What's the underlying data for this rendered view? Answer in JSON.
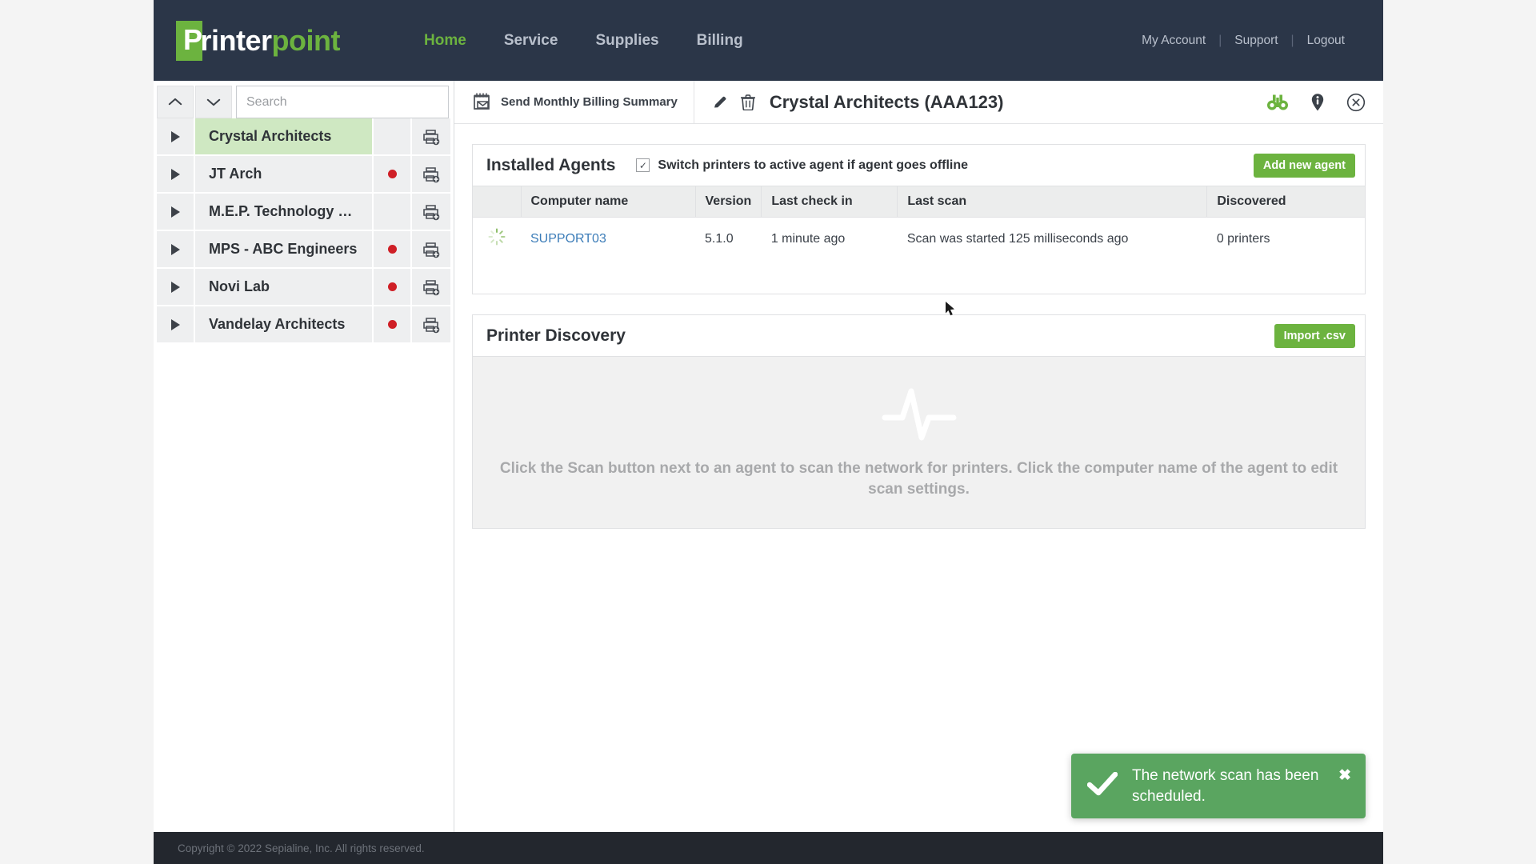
{
  "header": {
    "logo": {
      "badge_letter": "P",
      "white_part": "rinter",
      "green_part": "point",
      "accent": "#6cb33f"
    },
    "nav": [
      {
        "label": "Home",
        "active": true
      },
      {
        "label": "Service",
        "active": false
      },
      {
        "label": "Supplies",
        "active": false
      },
      {
        "label": "Billing",
        "active": false
      }
    ],
    "account_links": [
      {
        "label": "My Account"
      },
      {
        "label": "Support"
      },
      {
        "label": "Logout"
      }
    ],
    "separator": "|"
  },
  "sidebar": {
    "collapse_all_icon": "chevron-up-icon",
    "expand_all_icon": "chevron-down-icon",
    "search": {
      "value": "",
      "placeholder": "Search"
    },
    "customers": [
      {
        "name": "Crystal Architects",
        "selected": true,
        "alert": false
      },
      {
        "name": "JT Arch",
        "selected": false,
        "alert": true
      },
      {
        "name": "M.E.P. Technology …",
        "selected": false,
        "alert": false
      },
      {
        "name": "MPS - ABC Engineers",
        "selected": false,
        "alert": true
      },
      {
        "name": "Novi Lab",
        "selected": false,
        "alert": true
      },
      {
        "name": "Vandelay Architects",
        "selected": false,
        "alert": true
      }
    ],
    "row_print_icon": "add-printer-icon",
    "alert_color": "#cf1f26",
    "selected_bg": "#cfe8c2"
  },
  "context_bar": {
    "billing_button": {
      "label": "Send Monthly Billing Summary",
      "icon": "calendar-mail-icon"
    },
    "edit_icon": "pencil-icon",
    "delete_icon": "trash-icon",
    "title": "Crystal Architects (AAA123)",
    "right_icons": [
      {
        "name": "binoculars-icon",
        "color": "#6cb33f"
      },
      {
        "name": "info-pin-icon",
        "color": "#3b4149"
      },
      {
        "name": "close-circle-icon",
        "color": "#3b4149"
      }
    ]
  },
  "installed_agents": {
    "title": "Installed Agents",
    "switch_option": {
      "label": "Switch printers to active agent if agent goes offline",
      "checked": true
    },
    "add_button": "Add new agent",
    "columns": [
      "",
      "Computer name",
      "Version",
      "Last check in",
      "Last scan",
      "Discovered"
    ],
    "rows": [
      {
        "status_icon": "spinner-icon",
        "computer_name": "SUPPORT03",
        "version": "5.1.0",
        "last_check_in": "1 minute ago",
        "last_scan": "Scan was started 125 milliseconds ago",
        "discovered": "0 printers"
      }
    ]
  },
  "printer_discovery": {
    "title": "Printer Discovery",
    "import_button": "Import .csv",
    "empty_icon": "pulse-icon",
    "empty_text": "Click the Scan button next to an agent to scan the network for printers. Click the computer name of the agent to edit scan settings."
  },
  "toast": {
    "message": "The network scan has been scheduled.",
    "icon": "checkmark-icon",
    "close_label": "✖",
    "color": "#5aa560"
  },
  "footer": {
    "copyright": "Copyright © 2022 Sepialine, Inc. All rights reserved."
  }
}
